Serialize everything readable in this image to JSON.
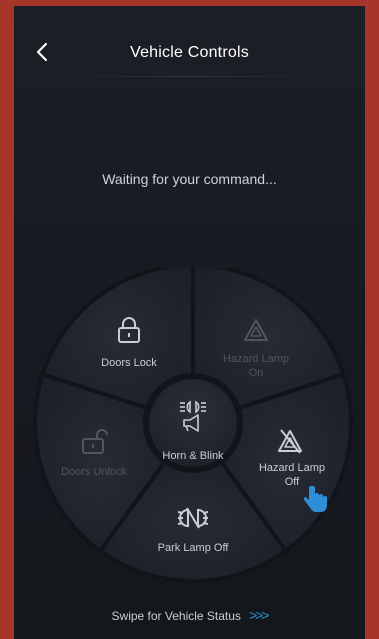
{
  "header": {
    "title": "Vehicle Controls",
    "back_icon": "chevron-left-icon"
  },
  "status": {
    "message": "Waiting for your command..."
  },
  "wheel": {
    "segments": [
      {
        "id": "doors-lock",
        "label": "Doors Lock",
        "icon": "lock-icon",
        "enabled": true
      },
      {
        "id": "hazard-on",
        "label_line1": "Hazard Lamp",
        "label_line2": "On",
        "icon": "hazard-triangle-icon",
        "enabled": false
      },
      {
        "id": "hazard-off",
        "label_line1": "Hazard Lamp",
        "label_line2": "Off",
        "icon": "hazard-off-icon",
        "enabled": true
      },
      {
        "id": "park-lamp-off",
        "label": "Park Lamp Off",
        "icon": "park-lamp-off-icon",
        "enabled": true
      },
      {
        "id": "doors-unlock",
        "label": "Doors Unlock",
        "icon": "unlock-icon",
        "enabled": false
      }
    ],
    "center": {
      "label": "Horn & Blink",
      "icon": "horn-blink-icon"
    }
  },
  "footer": {
    "label": "Swipe for Vehicle Status",
    "chevrons": ">>>"
  },
  "colors": {
    "accent": "#2f8fd6",
    "background": "#1a1d23",
    "frame": "#a8352a"
  }
}
